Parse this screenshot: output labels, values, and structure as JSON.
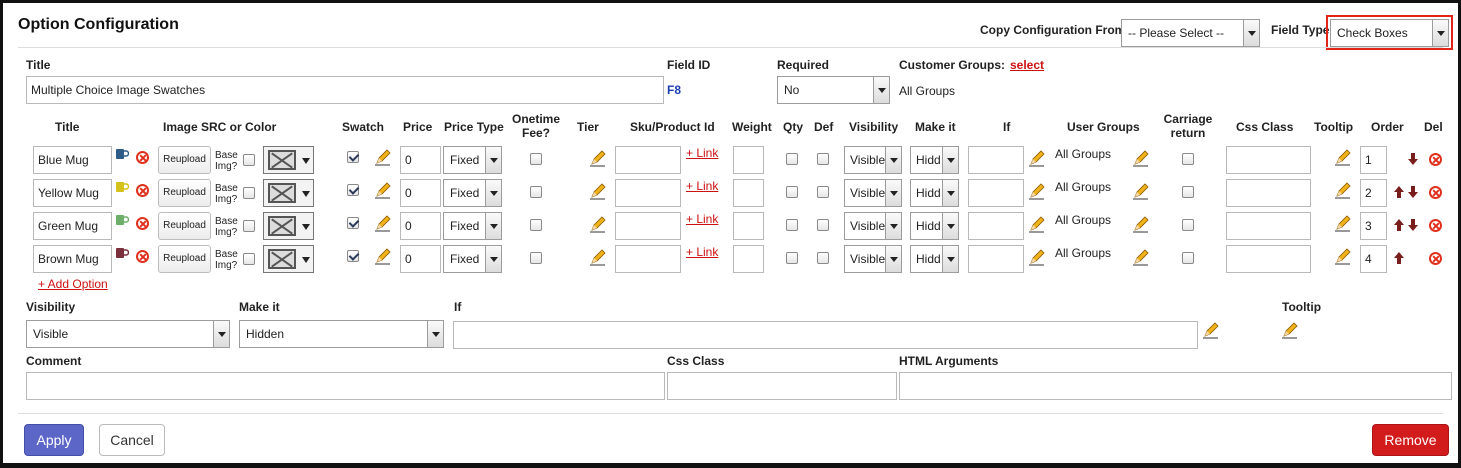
{
  "header": {
    "title": "Option Configuration",
    "copy_from_label": "Copy Configuration From:",
    "copy_from_value": "-- Please Select --",
    "field_type_label": "Field Type",
    "field_type_value": "Check Boxes"
  },
  "field": {
    "title_label": "Title",
    "title_value": "Multiple Choice Image Swatches",
    "field_id_label": "Field ID",
    "field_id_value": "F8",
    "required_label": "Required",
    "required_value": "No",
    "customer_groups_label": "Customer Groups:",
    "customer_groups_link": "select",
    "customer_groups_value": "All Groups"
  },
  "columns": {
    "title": "Title",
    "image": "Image SRC or Color",
    "swatch": "Swatch",
    "price": "Price",
    "price_type": "Price Type",
    "onetime": "Onetime Fee?",
    "tier": "Tier",
    "sku": "Sku/Product Id",
    "weight": "Weight",
    "qty": "Qty",
    "def": "Def",
    "visibility": "Visibility",
    "make_it": "Make it",
    "if": "If",
    "user_groups": "User Groups",
    "carriage": "Carriage return",
    "css_class": "Css Class",
    "tooltip": "Tooltip",
    "order": "Order",
    "del": "Del"
  },
  "rows": [
    {
      "title": "Blue Mug",
      "mug_color": "#2f5d8a",
      "reupload": "Reupload",
      "base_img": "Base Img?",
      "swatch": true,
      "price": "0",
      "price_type": "Fixed",
      "link": "+ Link",
      "visibility": "Visible",
      "make_it": "Hidd",
      "user_groups": "All Groups",
      "order": "1",
      "up": false,
      "down": true
    },
    {
      "title": "Yellow Mug",
      "mug_color": "#d4c21a",
      "reupload": "Reupload",
      "base_img": "Base Img?",
      "swatch": true,
      "price": "0",
      "price_type": "Fixed",
      "link": "+ Link",
      "visibility": "Visible",
      "make_it": "Hidd",
      "user_groups": "All Groups",
      "order": "2",
      "up": true,
      "down": true
    },
    {
      "title": "Green Mug",
      "mug_color": "#6fae6a",
      "reupload": "Reupload",
      "base_img": "Base Img?",
      "swatch": true,
      "price": "0",
      "price_type": "Fixed",
      "link": "+ Link",
      "visibility": "Visible",
      "make_it": "Hidd",
      "user_groups": "All Groups",
      "order": "3",
      "up": true,
      "down": true
    },
    {
      "title": "Brown Mug",
      "mug_color": "#7a2f3a",
      "reupload": "Reupload",
      "base_img": "Base Img?",
      "swatch": true,
      "price": "0",
      "price_type": "Fixed",
      "link": "+ Link",
      "visibility": "Visible",
      "make_it": "Hidd",
      "user_groups": "All Groups",
      "order": "4",
      "up": true,
      "down": false
    }
  ],
  "add_option": "+ Add Option",
  "bottom": {
    "visibility_label": "Visibility",
    "visibility_value": "Visible",
    "make_it_label": "Make it",
    "make_it_value": "Hidden",
    "if_label": "If",
    "tooltip_label": "Tooltip",
    "comment_label": "Comment",
    "css_class_label": "Css Class",
    "html_args_label": "HTML Arguments"
  },
  "buttons": {
    "apply": "Apply",
    "cancel": "Cancel",
    "remove": "Remove"
  },
  "colors": {
    "apply": "#5b66c7",
    "remove": "#d21c1c",
    "link": "#cc1111",
    "field_id": "#1a3fb0"
  }
}
